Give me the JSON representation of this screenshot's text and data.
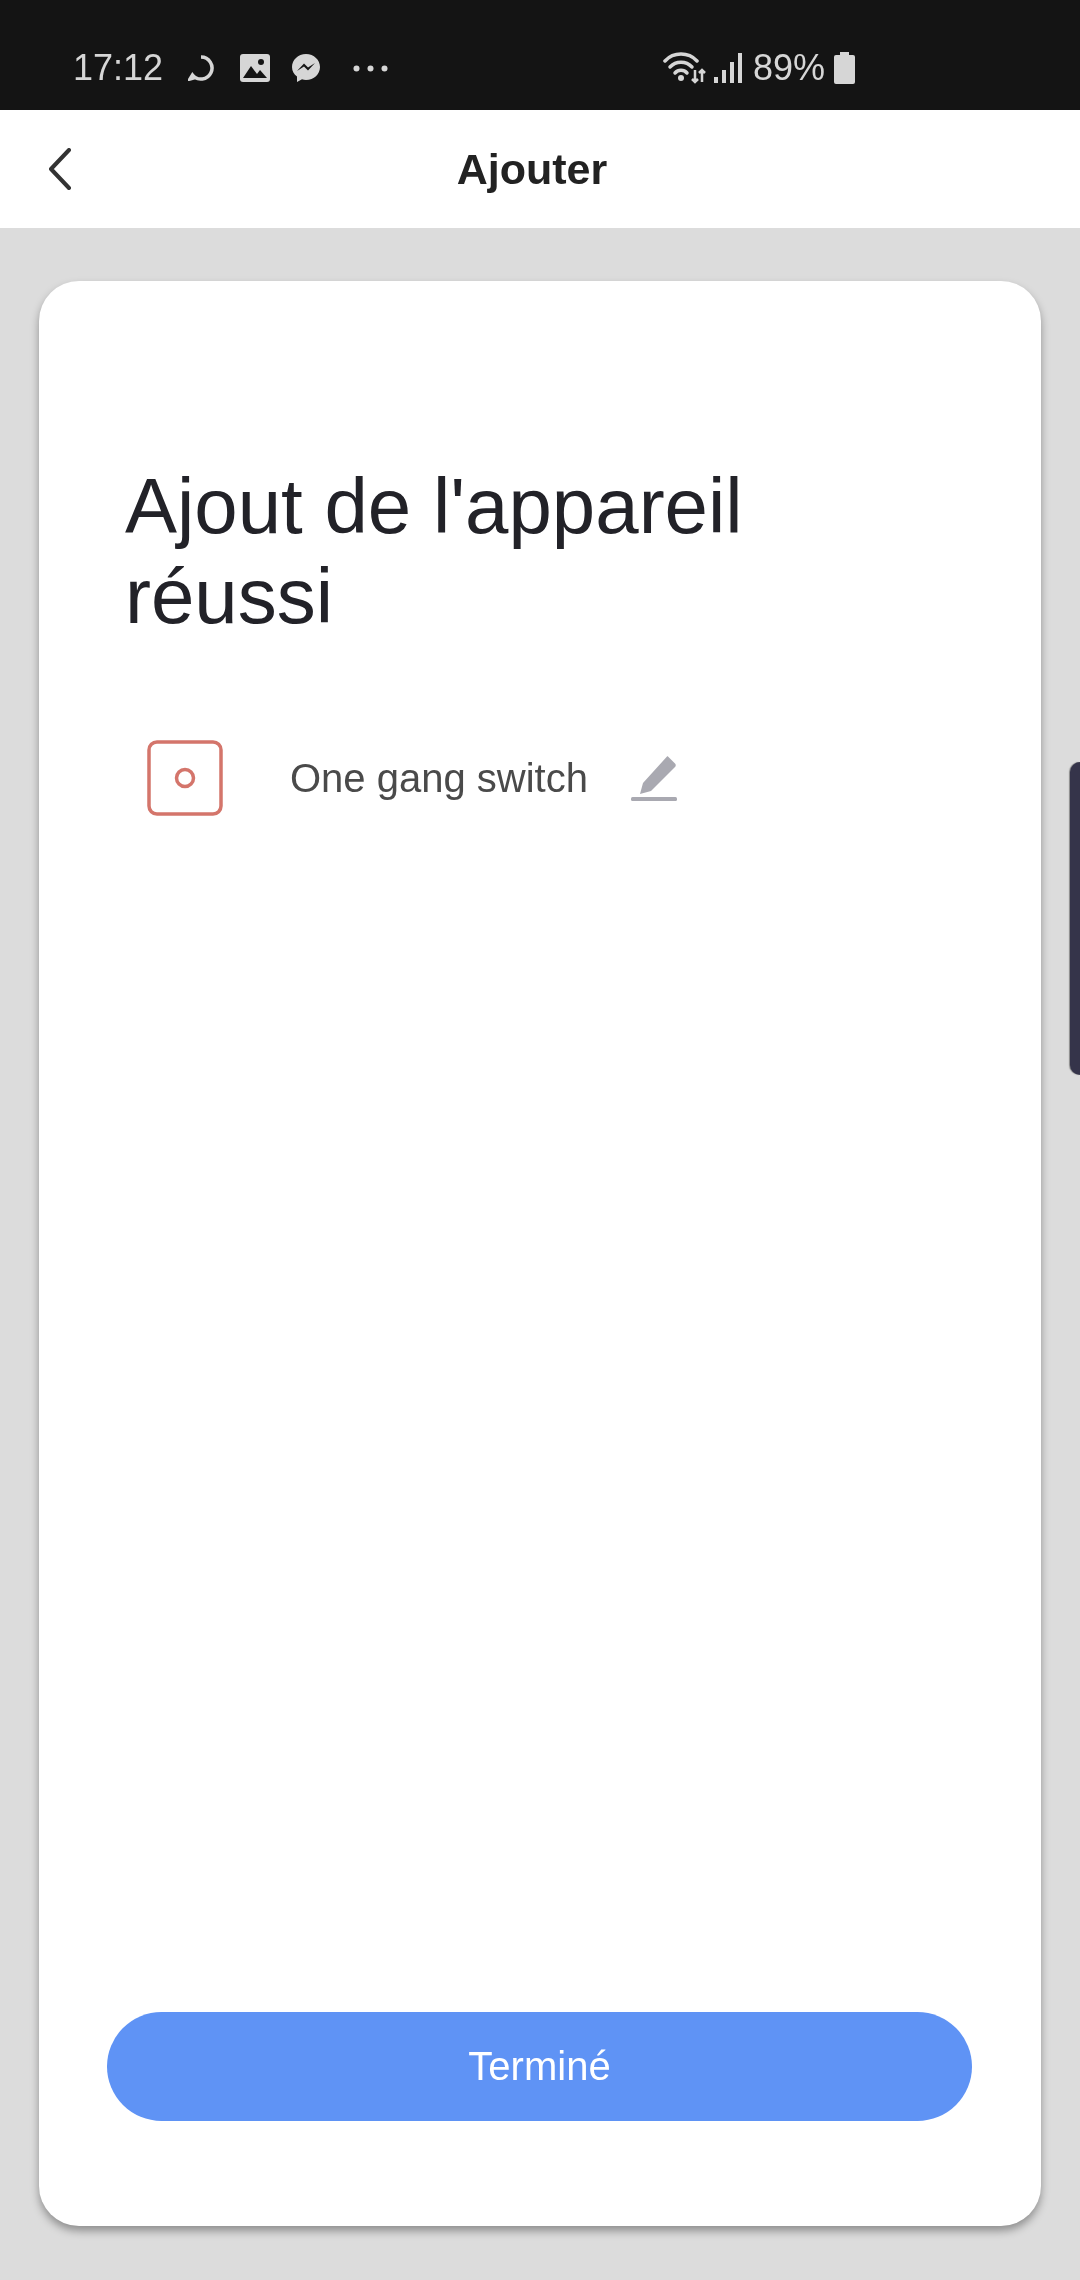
{
  "status_bar": {
    "time": "17:12",
    "battery": "89%"
  },
  "header": {
    "title": "Ajouter"
  },
  "card": {
    "title": "Ajout de l'appareil réussi",
    "device": {
      "name": "One gang switch"
    },
    "button": {
      "label": "Terminé"
    }
  }
}
